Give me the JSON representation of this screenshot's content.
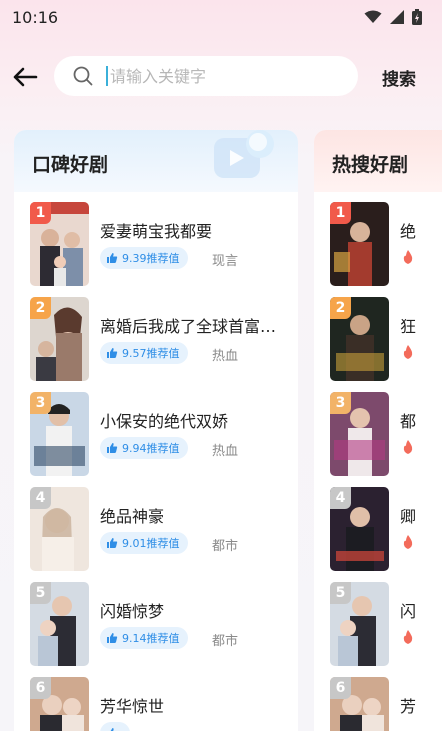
{
  "status_bar": {
    "time": "10:16"
  },
  "search": {
    "placeholder": "请输入关键字",
    "button_label": "搜索"
  },
  "colors": {
    "accent": "#3bb0d9",
    "badge_bg": "#e6f2fd",
    "badge_text": "#2f8ee6",
    "rank1": "#f15a4a",
    "rank2": "#f6a44a",
    "rank3": "#f2b368",
    "fire": "#f36b5b"
  },
  "left_panel": {
    "title": "口碑好剧",
    "items": [
      {
        "rank": "1",
        "title": "爱妻萌宝我都要",
        "score": "9.39推荐值",
        "genre": "现言"
      },
      {
        "rank": "2",
        "title": "离婚后我成了全球首富…",
        "score": "9.57推荐值",
        "genre": "热血"
      },
      {
        "rank": "3",
        "title": "小保安的绝代双娇",
        "score": "9.94推荐值",
        "genre": "热血"
      },
      {
        "rank": "4",
        "title": "绝品神豪",
        "score": "9.01推荐值",
        "genre": "都市"
      },
      {
        "rank": "5",
        "title": "闪婚惊梦",
        "score": "9.14推荐值",
        "genre": "都市"
      },
      {
        "rank": "6",
        "title": "芳华惊世",
        "score": "",
        "genre": ""
      }
    ]
  },
  "right_panel": {
    "title": "热搜好剧",
    "items": [
      {
        "rank": "1",
        "title": "绝"
      },
      {
        "rank": "2",
        "title": "狂"
      },
      {
        "rank": "3",
        "title": "都"
      },
      {
        "rank": "4",
        "title": "卿"
      },
      {
        "rank": "5",
        "title": "闪"
      },
      {
        "rank": "6",
        "title": "芳"
      }
    ]
  }
}
